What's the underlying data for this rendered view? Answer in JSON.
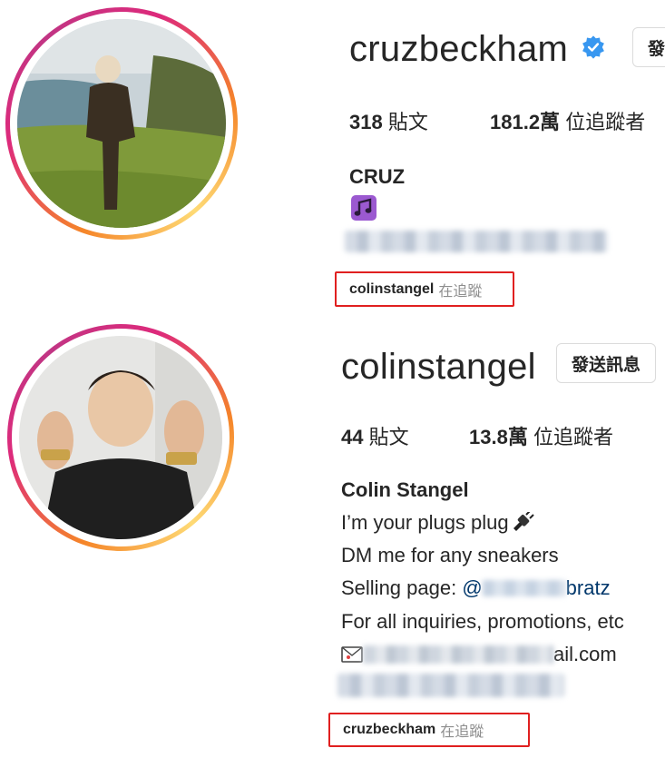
{
  "profile1": {
    "username": "cruzbeckham",
    "message_button": "發",
    "posts_count": "318",
    "posts_label": "貼文",
    "followers_count": "181.2萬",
    "followers_label": "位追蹤者",
    "full_name": "CRUZ",
    "followed_by_user": "colinstangel",
    "followed_by_text": "在追蹤"
  },
  "profile2": {
    "username": "colinstangel",
    "message_button": "發送訊息",
    "posts_count": "44",
    "posts_label": "貼文",
    "followers_count": "13.8萬",
    "followers_label": "位追蹤者",
    "full_name": "Colin Stangel",
    "bio_line1": "I’m your plugs plug",
    "bio_line2": "DM me for any sneakers",
    "bio_line3_prefix": "Selling page: ",
    "bio_line3_link_start": "@",
    "bio_line3_link_end": "bratz",
    "bio_line4": "For all inquiries, promotions, etc",
    "bio_line5_end": "ail.com",
    "followed_by_user": "cruzbeckham",
    "followed_by_text": "在追蹤"
  },
  "colors": {
    "verified_blue": "#3897f0",
    "highlight_red": "#e02020",
    "link_blue": "#00376b"
  }
}
